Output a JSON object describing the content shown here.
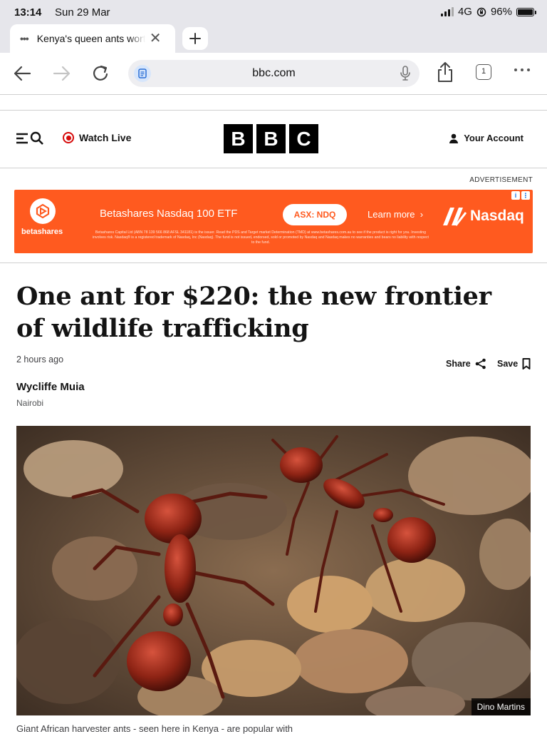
{
  "status_bar": {
    "time": "13:14",
    "date": "Sun 29 Mar",
    "network": "4G",
    "battery": "96%"
  },
  "browser": {
    "tab_title": "Kenya's queen ants worth",
    "url": "bbc.com",
    "tab_count": "1"
  },
  "header": {
    "watch_live": "Watch Live",
    "logo_letters": [
      "B",
      "B",
      "C"
    ],
    "account": "Your Account"
  },
  "advert": {
    "label": "ADVERTISEMENT",
    "brand": "betashares",
    "headline": "Betashares Nasdaq 100 ETF",
    "ticker": "ASX: NDQ",
    "cta": "Learn more",
    "partner": "Nasdaq",
    "fine_print": "Betashares Capital Ltd (ABN 78 139 566 868 AFSL 341181) is the issuer. Read the PDS and Target market Determination (TMD) at www.betashares.com.au to see if the product is right for you. Investing involves risk. Nasdaq® is a registered trademark of Nasdaq, Inc (Nasdaq). The fund is not issued, endorsed, sold or promoted by Nasdaq and Nasdaq makes no warranties and bears no liability with respect to the fund."
  },
  "article": {
    "headline": "One ant for $220: the new frontier of wildlife trafficking",
    "timestamp": "2 hours ago",
    "share_label": "Share",
    "save_label": "Save",
    "author": "Wycliffe Muia",
    "location": "Nairobi",
    "photo_credit": "Dino Martins",
    "caption": "Giant African harvester ants - seen here in Kenya - are popular with"
  },
  "colors": {
    "ad_orange": "#ff5a1f",
    "live_red": "#d60a0a",
    "bbc_black": "#000000"
  }
}
